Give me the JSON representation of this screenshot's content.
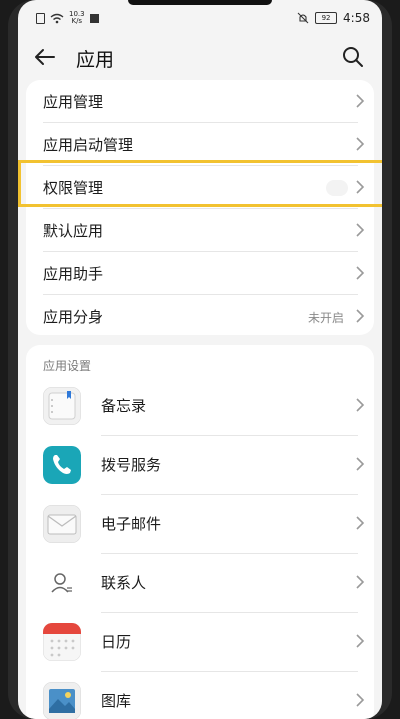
{
  "status": {
    "net_speed_value": "10.3",
    "net_speed_unit": "K/s",
    "battery": "92",
    "time": "4:58"
  },
  "header": {
    "title": "应用"
  },
  "main_list": [
    {
      "label": "应用管理"
    },
    {
      "label": "应用启动管理"
    },
    {
      "label": "权限管理"
    },
    {
      "label": "默认应用"
    },
    {
      "label": "应用助手"
    },
    {
      "label": "应用分身",
      "value": "未开启"
    }
  ],
  "app_settings": {
    "section_title": "应用设置",
    "items": [
      {
        "label": "备忘录",
        "icon": "notes-icon"
      },
      {
        "label": "拨号服务",
        "icon": "phone-icon"
      },
      {
        "label": "电子邮件",
        "icon": "email-icon"
      },
      {
        "label": "联系人",
        "icon": "contacts-icon"
      },
      {
        "label": "日历",
        "icon": "calendar-icon"
      },
      {
        "label": "图库",
        "icon": "gallery-icon"
      }
    ]
  },
  "colors": {
    "highlight": "#f2c230",
    "phone_teal": "#1aa6b7",
    "calendar_red": "#e5473d"
  }
}
